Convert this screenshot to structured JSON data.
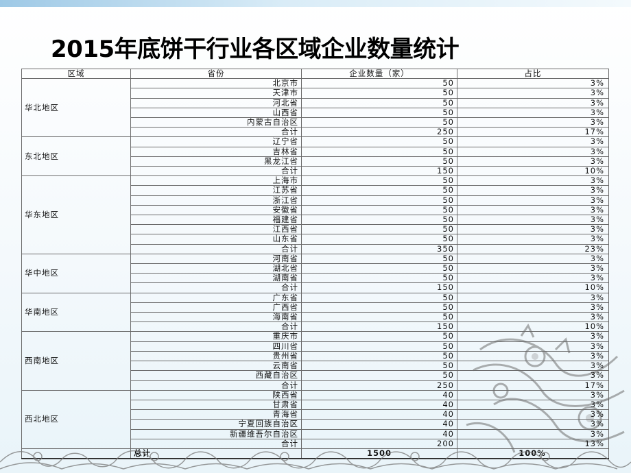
{
  "title": "2015年底饼干行业各区域企业数量统计",
  "table": {
    "headers": [
      "区域",
      "省份",
      "企业数量（家）",
      "占比"
    ],
    "regions": [
      {
        "name": "华北地区",
        "rows": [
          {
            "province": "北京市",
            "count": "50",
            "pct": "3%"
          },
          {
            "province": "天津市",
            "count": "50",
            "pct": "3%"
          },
          {
            "province": "河北省",
            "count": "50",
            "pct": "3%"
          },
          {
            "province": "山西省",
            "count": "50",
            "pct": "3%"
          },
          {
            "province": "内蒙古自治区",
            "count": "50",
            "pct": "3%"
          },
          {
            "province": "合计",
            "count": "250",
            "pct": "17%"
          }
        ]
      },
      {
        "name": "东北地区",
        "rows": [
          {
            "province": "辽宁省",
            "count": "50",
            "pct": "3%"
          },
          {
            "province": "吉林省",
            "count": "50",
            "pct": "3%"
          },
          {
            "province": "黑龙江省",
            "count": "50",
            "pct": "3%"
          },
          {
            "province": "合计",
            "count": "150",
            "pct": "10%"
          }
        ]
      },
      {
        "name": "华东地区",
        "rows": [
          {
            "province": "上海市",
            "count": "50",
            "pct": "3%"
          },
          {
            "province": "江苏省",
            "count": "50",
            "pct": "3%"
          },
          {
            "province": "浙江省",
            "count": "50",
            "pct": "3%"
          },
          {
            "province": "安徽省",
            "count": "50",
            "pct": "3%"
          },
          {
            "province": "福建省",
            "count": "50",
            "pct": "3%"
          },
          {
            "province": "江西省",
            "count": "50",
            "pct": "3%"
          },
          {
            "province": "山东省",
            "count": "50",
            "pct": "3%"
          },
          {
            "province": "合计",
            "count": "350",
            "pct": "23%"
          }
        ]
      },
      {
        "name": "华中地区",
        "rows": [
          {
            "province": "河南省",
            "count": "50",
            "pct": "3%"
          },
          {
            "province": "湖北省",
            "count": "50",
            "pct": "3%"
          },
          {
            "province": "湖南省",
            "count": "50",
            "pct": "3%"
          },
          {
            "province": "合计",
            "count": "150",
            "pct": "10%"
          }
        ]
      },
      {
        "name": "华南地区",
        "rows": [
          {
            "province": "广东省",
            "count": "50",
            "pct": "3%"
          },
          {
            "province": "广西省",
            "count": "50",
            "pct": "3%"
          },
          {
            "province": "海南省",
            "count": "50",
            "pct": "3%"
          },
          {
            "province": "合计",
            "count": "150",
            "pct": "10%"
          }
        ]
      },
      {
        "name": "西南地区",
        "rows": [
          {
            "province": "重庆市",
            "count": "50",
            "pct": "3%"
          },
          {
            "province": "四川省",
            "count": "50",
            "pct": "3%"
          },
          {
            "province": "贵州省",
            "count": "50",
            "pct": "3%"
          },
          {
            "province": "云南省",
            "count": "50",
            "pct": "3%"
          },
          {
            "province": "西藏自治区",
            "count": "50",
            "pct": "3%"
          },
          {
            "province": "合计",
            "count": "250",
            "pct": "17%"
          }
        ]
      },
      {
        "name": "西北地区",
        "rows": [
          {
            "province": "陕西省",
            "count": "40",
            "pct": "3%"
          },
          {
            "province": "甘肃省",
            "count": "40",
            "pct": "3%"
          },
          {
            "province": "青海省",
            "count": "40",
            "pct": "3%"
          },
          {
            "province": "宁夏回族自治区",
            "count": "40",
            "pct": "3%"
          },
          {
            "province": "新疆维吾尔自治区",
            "count": "40",
            "pct": "3%"
          },
          {
            "province": "合计",
            "count": "200",
            "pct": "13%"
          }
        ]
      }
    ],
    "total": {
      "label": "总计",
      "count": "1500",
      "pct": "100%"
    }
  }
}
